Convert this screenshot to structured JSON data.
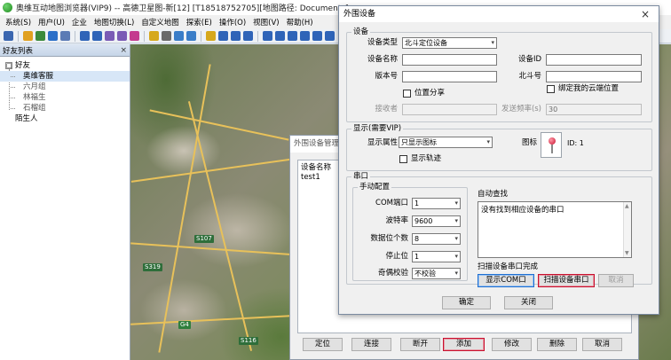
{
  "window": {
    "title": "奥维互动地图浏览器(VIP9) -- 高德卫星图-新[12] [T18518752705][地图路径: Documents]"
  },
  "menu": [
    "系统(S)",
    "用户(U)",
    "企业",
    "地图切换(L)",
    "自定义地图",
    "探索(E)",
    "操作(O)",
    "视图(V)",
    "帮助(H)"
  ],
  "left_panel": {
    "title": "好友列表",
    "close": "×",
    "groups": [
      {
        "name": "好友",
        "toggle": "□",
        "children": [
          "奥维客服",
          "六月组",
          "林福生",
          "石榴组"
        ]
      },
      {
        "name": "陌生人",
        "toggle": "",
        "children": []
      }
    ]
  },
  "map": {
    "labels": [
      "S319",
      "S107",
      "G4",
      "S116"
    ]
  },
  "manager_dialog": {
    "title": "外围设备管理",
    "list_header": "设备名称",
    "devices": [
      "test1"
    ],
    "buttons": {
      "locate": "定位",
      "connect": "连接",
      "disconnect": "断开",
      "add": "添加",
      "modify": "修改",
      "delete": "删除",
      "cancel": "取消"
    }
  },
  "device_dialog": {
    "title": "外围设备",
    "close": "×",
    "device_group": {
      "label": "设备",
      "type_label": "设备类型",
      "type_value": "北斗定位设备",
      "name_label": "设备名称",
      "name_value": "",
      "id_label": "设备ID",
      "id_value": "",
      "version_label": "版本号",
      "version_value": "",
      "beidou_label": "北斗号",
      "beidou_value": "",
      "share_label": "位置分享",
      "bind_label": "绑定我的云端位置",
      "receiver_label": "接收者",
      "receiver_value": "",
      "freq_label": "发送频率(s)",
      "freq_value": "30"
    },
    "display_group": {
      "label": "显示(需要VIP)",
      "attr_label": "显示属性",
      "attr_value": "只显示图标",
      "icon_label": "图标",
      "icon_id": "ID: 1",
      "track_label": "显示轨迹"
    },
    "serial_group": {
      "label": "串口",
      "manual_label": "手动配置",
      "com_label": "COM端口",
      "com_value": "1",
      "baud_label": "波特率",
      "baud_value": "9600",
      "data_label": "数据位个数",
      "data_value": "8",
      "stop_label": "停止位",
      "stop_value": "1",
      "parity_label": "奇偶校验",
      "parity_value": "不校验",
      "auto_label": "自动查找",
      "auto_result": "没有找到相应设备的串口",
      "scan_status": "扫描设备串口完成",
      "show_com_button": "显示COM口",
      "scan_button": "扫描设备串口",
      "cancel_button": "取消"
    },
    "ok_button": "确定",
    "close_button": "关闭"
  },
  "colors": {
    "red_outline": "#c8102e",
    "blue_outline": "#1f6fd1",
    "road_yellow": "#e8c15a"
  }
}
